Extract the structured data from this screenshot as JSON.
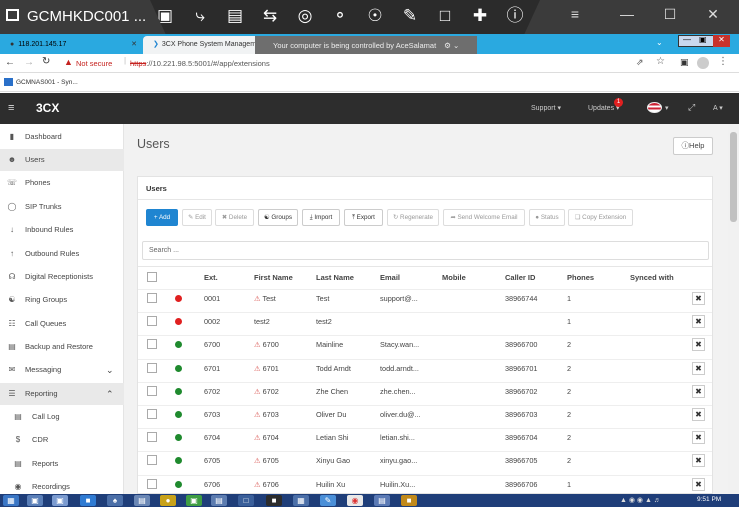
{
  "remote_bar": {
    "title": "GCMHKDC001 ...",
    "tools": [
      "monitor-icon",
      "bolt-icon",
      "briefcase-icon",
      "swap-icon",
      "camera-icon",
      "mic-icon",
      "users-icon",
      "pen-icon",
      "chat-icon",
      "plus-icon",
      "info-icon"
    ]
  },
  "browser": {
    "tab1": "118.201.145.17",
    "tab2": "3CX Phone System Managem...",
    "overlay": "Your computer is being controlled by AceSalamat",
    "not_secure": "Not secure",
    "url_scheme": "https",
    "url_rest": "://10.221.98.5:5001/#/app/extensions",
    "bookmark": "GCMNAS001 - Syn..."
  },
  "appbar": {
    "logo": "3CX",
    "support": "Support",
    "updates": "Updates",
    "updates_badge": "1",
    "user": "A"
  },
  "sidebar": {
    "items": [
      {
        "label": "Dashboard",
        "icon": "bar-chart-icon"
      },
      {
        "label": "Users",
        "icon": "user-icon"
      },
      {
        "label": "Phones",
        "icon": "phone-icon"
      },
      {
        "label": "SIP Trunks",
        "icon": "globe-icon"
      },
      {
        "label": "Inbound Rules",
        "icon": "arrow-down-icon"
      },
      {
        "label": "Outbound Rules",
        "icon": "arrow-up-icon"
      },
      {
        "label": "Digital Receptionists",
        "icon": "headset-icon"
      },
      {
        "label": "Ring Groups",
        "icon": "group-icon"
      },
      {
        "label": "Call Queues",
        "icon": "queue-icon"
      },
      {
        "label": "Backup and Restore",
        "icon": "database-icon"
      },
      {
        "label": "Messaging",
        "icon": "message-icon"
      },
      {
        "label": "Reporting",
        "icon": "list-icon"
      },
      {
        "label": "Call Log",
        "icon": "log-icon"
      },
      {
        "label": "CDR",
        "icon": "dollar-icon"
      },
      {
        "label": "Reports",
        "icon": "report-icon"
      },
      {
        "label": "Recordings",
        "icon": "recording-icon"
      }
    ]
  },
  "page": {
    "title": "Users",
    "help": "Help",
    "panel_title": "Users",
    "search_placeholder": "Search ..."
  },
  "toolbar": {
    "add": "Add",
    "edit": "Edit",
    "delete": "Delete",
    "groups": "Groups",
    "import": "Import",
    "export": "Export",
    "regenerate": "Regenerate",
    "welcome": "Send Welcome Email",
    "status": "Status",
    "copy": "Copy Extension"
  },
  "table": {
    "columns": [
      "Ext.",
      "First Name",
      "Last Name",
      "Email",
      "Mobile",
      "Caller ID",
      "Phones",
      "Synced with"
    ],
    "rows": [
      {
        "status": "#e02020",
        "ext": "0001",
        "first": "Test",
        "warn": true,
        "last": "Test",
        "email": "support@...",
        "mobile": "",
        "caller": "38966744",
        "phones": "1"
      },
      {
        "status": "#e02020",
        "ext": "0002",
        "first": "test2",
        "warn": false,
        "last": "test2",
        "email": "",
        "mobile": "",
        "caller": "",
        "phones": "1"
      },
      {
        "status": "#1f8a2e",
        "ext": "6700",
        "first": "6700",
        "warn": true,
        "last": "Mainline",
        "email": "Stacy.wan...",
        "mobile": "",
        "caller": "38966700",
        "phones": "2"
      },
      {
        "status": "#1f8a2e",
        "ext": "6701",
        "first": "6701",
        "warn": true,
        "last": "Todd Arndt",
        "email": "todd.arndt...",
        "mobile": "",
        "caller": "38966701",
        "phones": "2"
      },
      {
        "status": "#1f8a2e",
        "ext": "6702",
        "first": "6702",
        "warn": true,
        "last": "Zhe Chen",
        "email": "zhe.chen...",
        "mobile": "",
        "caller": "38966702",
        "phones": "2"
      },
      {
        "status": "#1f8a2e",
        "ext": "6703",
        "first": "6703",
        "warn": true,
        "last": "Oliver Du",
        "email": "oliver.du@...",
        "mobile": "",
        "caller": "38966703",
        "phones": "2"
      },
      {
        "status": "#1f8a2e",
        "ext": "6704",
        "first": "6704",
        "warn": true,
        "last": "Letian Shi",
        "email": "letian.shi...",
        "mobile": "",
        "caller": "38966704",
        "phones": "2"
      },
      {
        "status": "#1f8a2e",
        "ext": "6705",
        "first": "6705",
        "warn": true,
        "last": "Xinyu Gao",
        "email": "xinyu.gao...",
        "mobile": "",
        "caller": "38966705",
        "phones": "2"
      },
      {
        "status": "#1f8a2e",
        "ext": "6706",
        "first": "6706",
        "warn": true,
        "last": "Huilin Xu",
        "email": "Huilin.Xu...",
        "mobile": "",
        "caller": "38966706",
        "phones": "1"
      }
    ]
  },
  "taskbar": {
    "time": "9:51 PM"
  },
  "colors": {
    "accent": "#1f85d1",
    "appbar": "#2d2d2d",
    "tabbar": "#2aa9e0",
    "offline": "#e02020",
    "online": "#1f8a2e"
  }
}
